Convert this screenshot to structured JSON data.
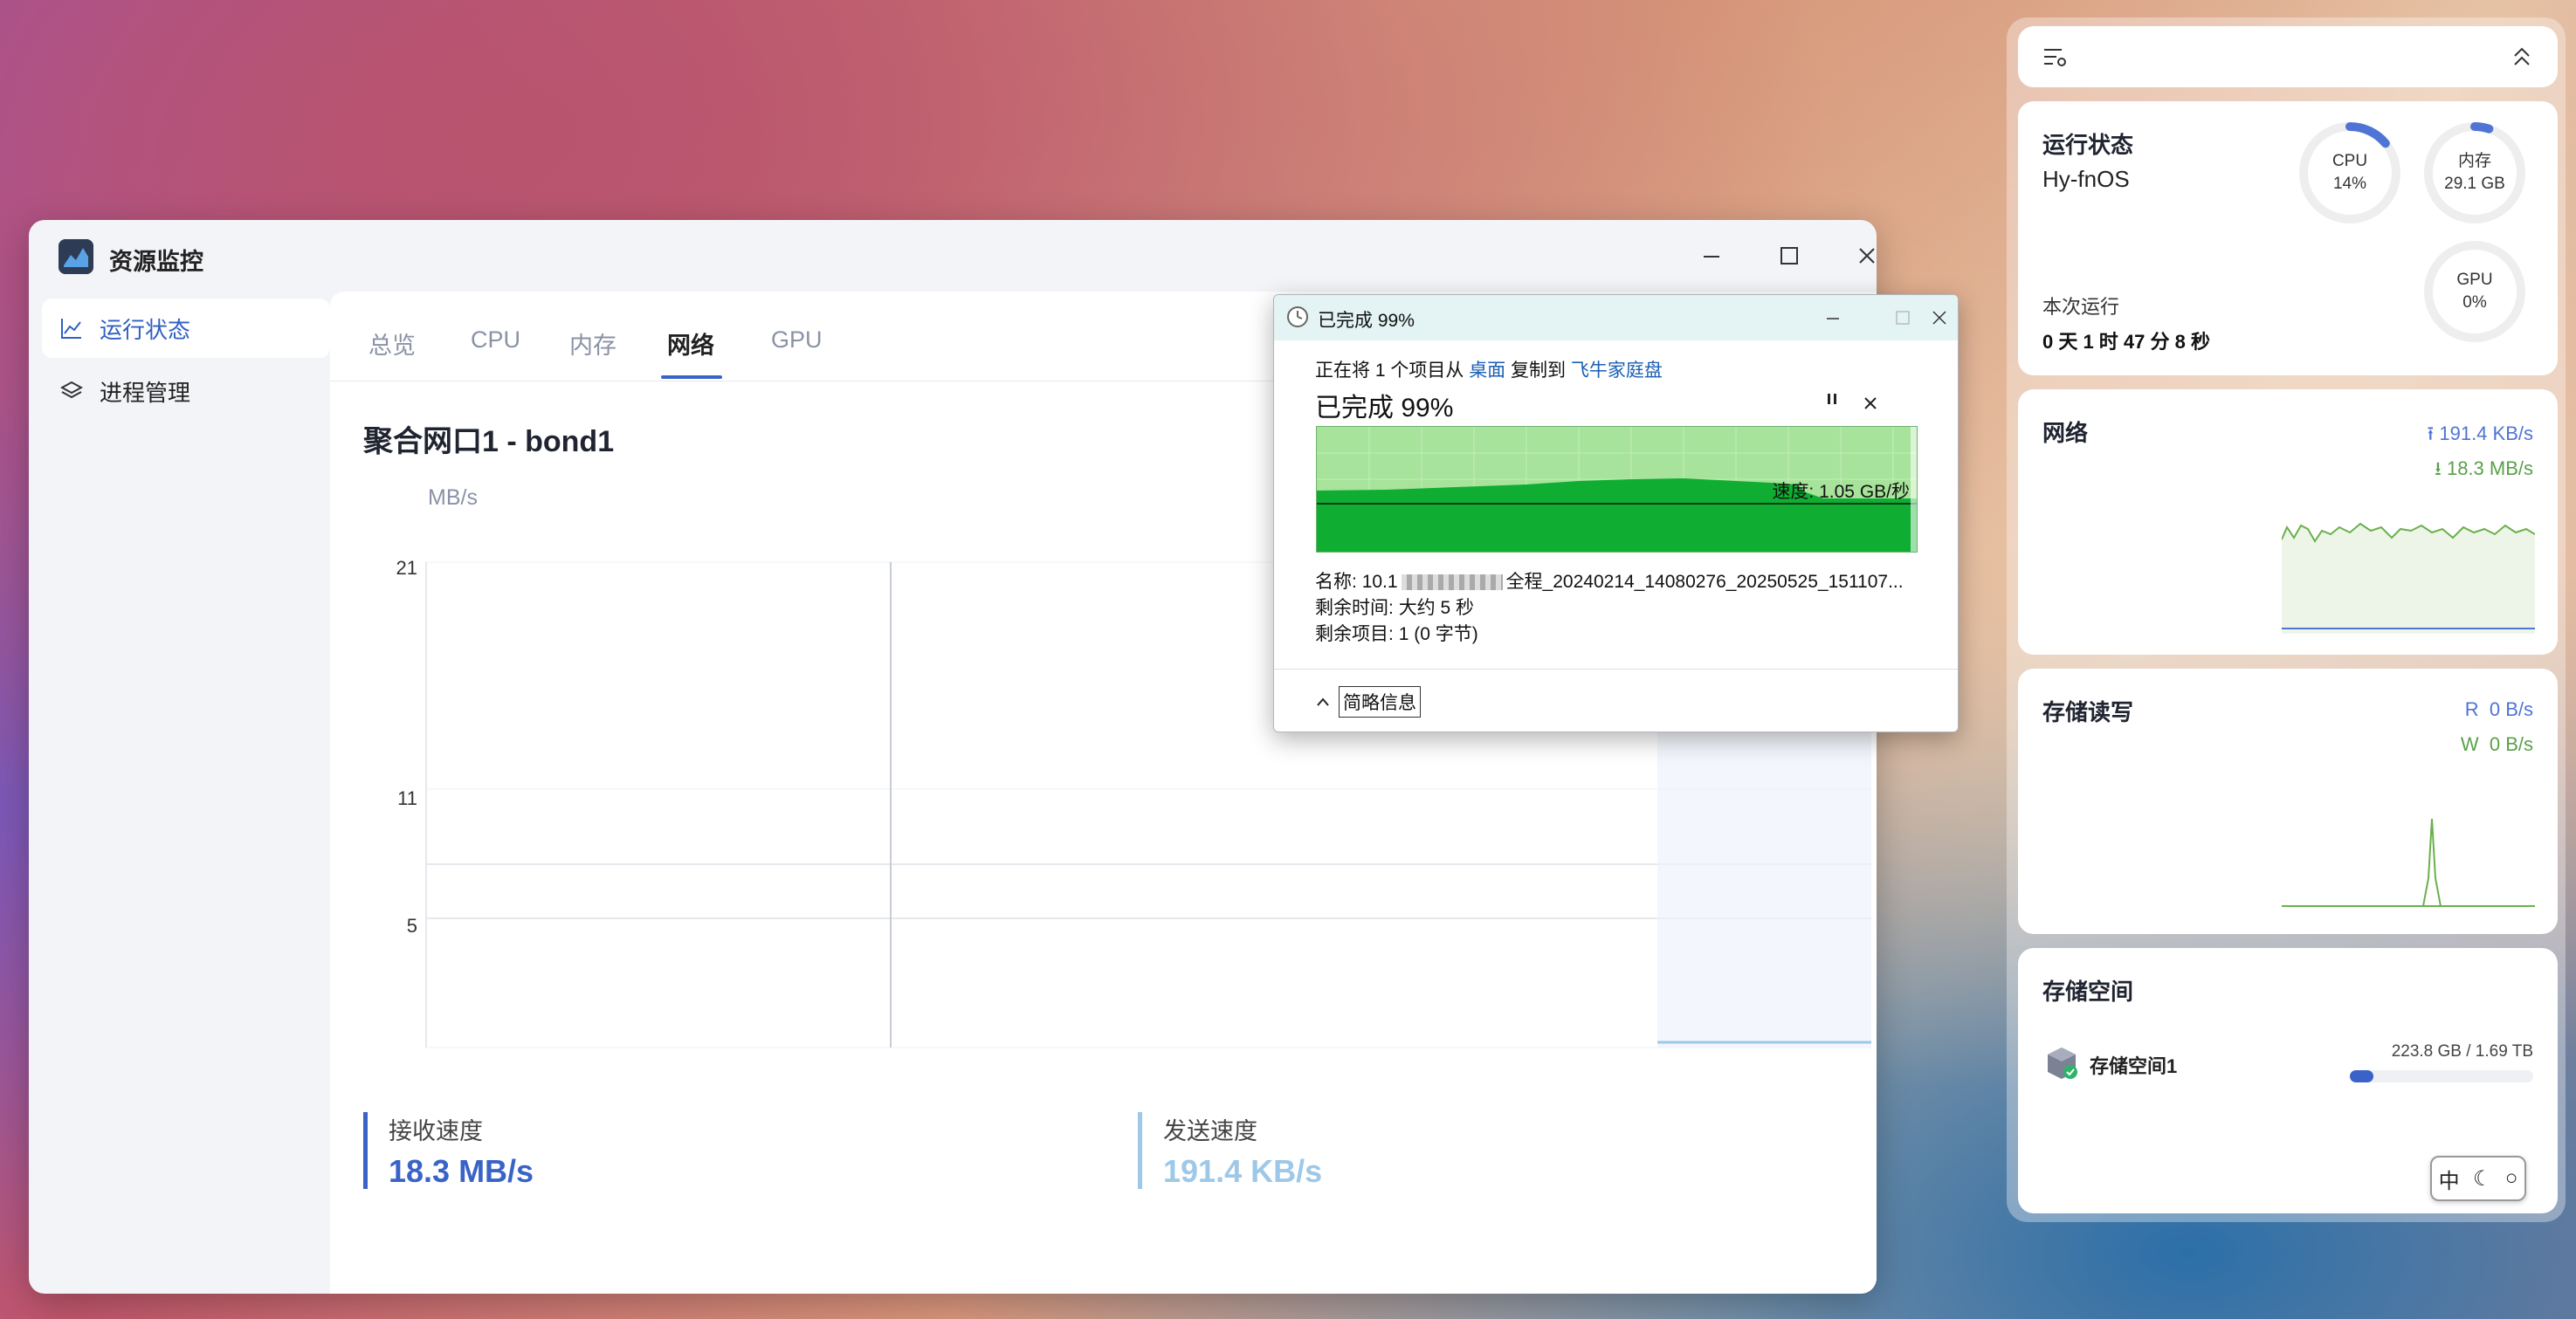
{
  "main_window": {
    "title": "资源监控",
    "sidebar": [
      {
        "label": "运行状态",
        "icon": "chart-line-icon",
        "active": true
      },
      {
        "label": "进程管理",
        "icon": "layers-icon",
        "active": false
      }
    ],
    "tabs": [
      "总览",
      "CPU",
      "内存",
      "网络",
      "GPU"
    ],
    "active_tab": "网络",
    "interface_title": "聚合网口1 - bond1",
    "unit": "MB/s",
    "y_ticks": [
      "21",
      "11",
      "5"
    ],
    "stats": {
      "receive_label": "接收速度",
      "receive_value": "18.3 MB/s",
      "send_label": "发送速度",
      "send_value": "191.4 KB/s"
    },
    "colors": {
      "accent": "#3a63c8",
      "send": "#9ec8e8"
    }
  },
  "copy_dialog": {
    "title": "已完成 99%",
    "line1_prefix": "正在将 1 个项目从 ",
    "line1_from": "桌面",
    "line1_mid": " 复制到 ",
    "line1_to": "飞牛家庭盘",
    "percent": "已完成 99%",
    "speed": "速度: 1.05 GB/秒",
    "name_label": "名称:",
    "name_value": "10.1",
    "name_suffix": "全程_20240214_14080276_20250525_151107...",
    "time_label": "剩余时间:",
    "time_value": "大约 5 秒",
    "items_label": "剩余项目:",
    "items_value": "1 (0 字节)",
    "less_info": "简略信息",
    "progress": 0.99
  },
  "widgets": {
    "status": {
      "title": "运行状态",
      "host": "Hy-fnOS",
      "cpu_label": "CPU",
      "cpu_value": "14%",
      "cpu_fraction": 0.14,
      "mem_label": "内存",
      "mem_value": "29.1 GB",
      "mem_fraction": 0.05,
      "gpu_label": "GPU",
      "gpu_value": "0%",
      "uptime_label": "本次运行",
      "uptime_value": "0 天 1 时 47 分 8 秒"
    },
    "network": {
      "title": "网络",
      "up": "191.4 KB/s",
      "down": "18.3 MB/s"
    },
    "disk_io": {
      "title": "存储读写",
      "read_label": "R",
      "read": "0 B/s",
      "write_label": "W",
      "write": "0 B/s"
    },
    "storage": {
      "title": "存储空间",
      "name": "存储空间1",
      "usage": "223.8 GB / 1.69 TB",
      "fraction": 0.13
    },
    "ime": {
      "mode": "中"
    }
  }
}
